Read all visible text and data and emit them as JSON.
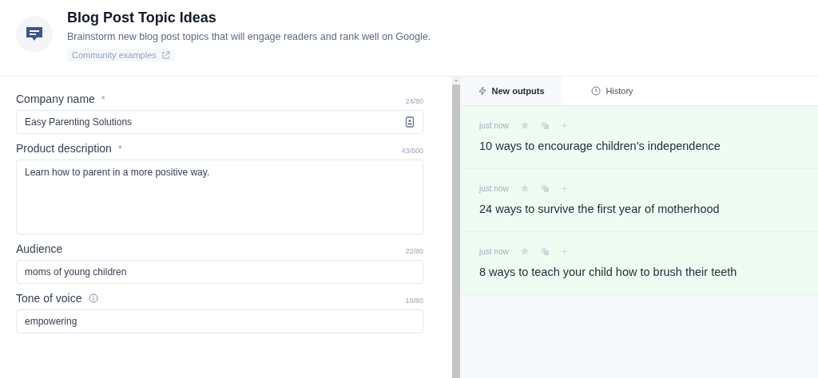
{
  "header": {
    "title": "Blog Post Topic Ideas",
    "description": "Brainstorm new blog post topics that will engage readers and rank well on Google.",
    "link": "Community examples"
  },
  "fields": [
    {
      "kind": "input",
      "label": "Company name",
      "required": "*",
      "info": false,
      "count": "24/80",
      "value": "Easy Parenting Solutions",
      "contact_icon": true
    },
    {
      "kind": "textarea",
      "label": "Product description",
      "required": "*",
      "info": false,
      "count": "43/600",
      "value": "Learn how to parent in a more positive way.",
      "contact_icon": false
    },
    {
      "kind": "input",
      "label": "Audience",
      "info": false,
      "count": "22/80",
      "value": "moms of young children",
      "contact_icon": false
    },
    {
      "kind": "input",
      "label": "Tone of voice",
      "info": true,
      "count": "10/80",
      "value": "empowering",
      "contact_icon": false
    }
  ],
  "tabs": [
    {
      "label": "New outputs",
      "kind": "bolt",
      "selected": true
    },
    {
      "label": "History",
      "kind": "clock",
      "selected": false
    }
  ],
  "outputs": [
    {
      "time": "just now",
      "starred": false,
      "text": "10 ways to encourage children's independence"
    },
    {
      "time": "just now",
      "starred": false,
      "text": "24 ways to survive the first year of motherhood"
    },
    {
      "time": "just now",
      "starred": false,
      "text": "8 ways to teach your child how to brush their teeth"
    }
  ]
}
